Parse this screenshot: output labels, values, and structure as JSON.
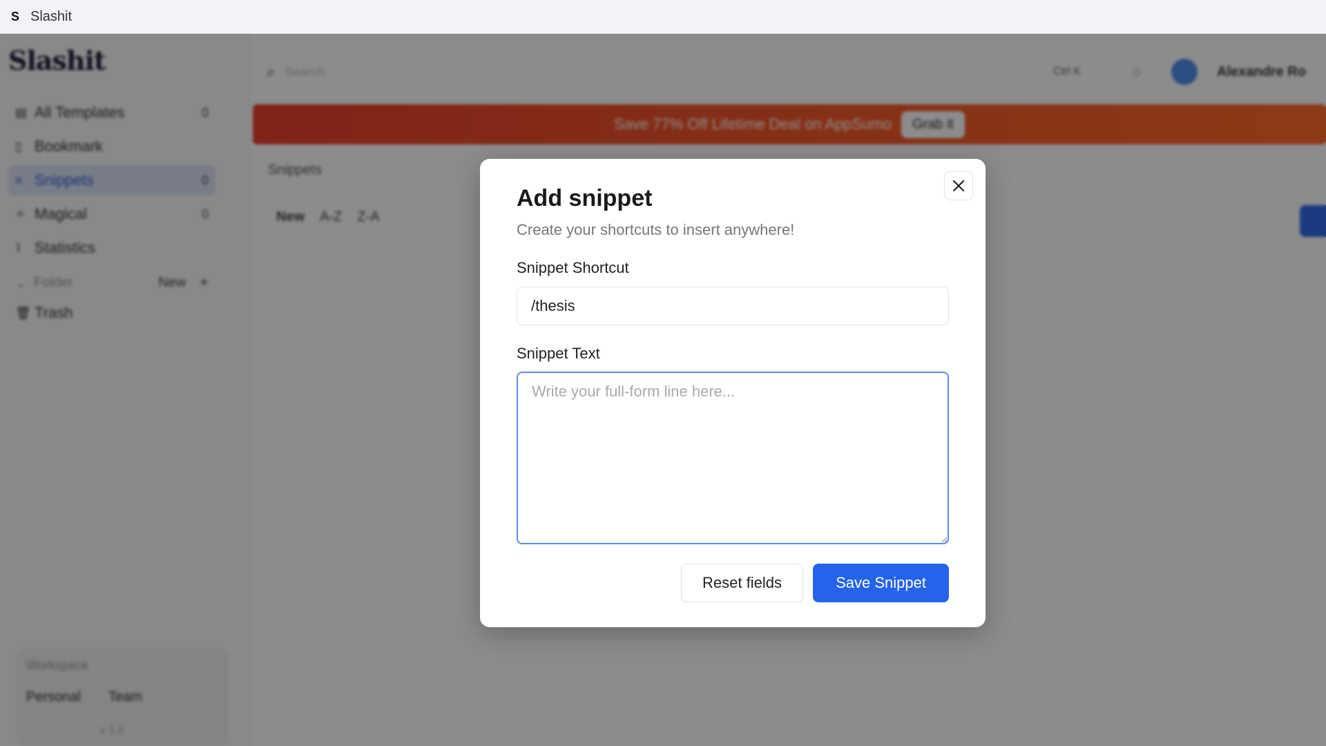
{
  "window": {
    "title": "Slashit",
    "logo_letter": "S"
  },
  "sidebar": {
    "brand": "Slashit",
    "items": [
      {
        "label": "All Templates",
        "count": "0",
        "icon": "template-icon"
      },
      {
        "label": "Bookmark",
        "count": "",
        "icon": "bookmark-icon"
      },
      {
        "label": "Snippets",
        "count": "0",
        "icon": "snippet-icon",
        "active": true
      },
      {
        "label": "Magical",
        "count": "0",
        "icon": "magic-icon"
      },
      {
        "label": "Statistics",
        "count": "",
        "icon": "chart-icon"
      }
    ],
    "folder_section": {
      "label": "Folder",
      "new_label": "New",
      "plus": "+"
    },
    "trash": {
      "label": "Trash"
    },
    "workspace": {
      "title": "Workspace",
      "personal": "Personal",
      "team": "Team"
    },
    "version": "v 1.0"
  },
  "main": {
    "search_placeholder": "Search",
    "shortcut_hint": "Ctrl K",
    "user_name": "Alexandre Ro",
    "promo": {
      "text": "Save 77% Off Lifetime Deal on AppSumo",
      "button": "Grab it"
    },
    "page_heading": "Snippets",
    "sort_tabs": [
      "New",
      "A-Z",
      "Z-A"
    ]
  },
  "modal": {
    "title": "Add snippet",
    "subtitle": "Create your shortcuts to insert anywhere!",
    "shortcut_label": "Snippet Shortcut",
    "shortcut_value": "/thesis",
    "text_label": "Snippet Text",
    "text_placeholder": "Write your full-form line here...",
    "reset_label": "Reset fields",
    "save_label": "Save Snippet"
  },
  "colors": {
    "primary": "#2563eb",
    "focus_border": "#5b8ce6",
    "promo_start": "#e8432c",
    "promo_end": "#ff6a2a"
  }
}
